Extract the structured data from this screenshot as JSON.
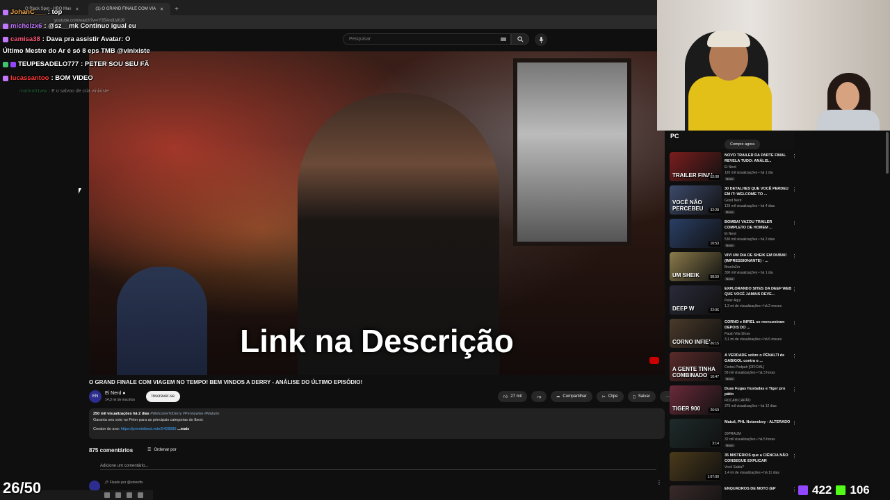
{
  "browser": {
    "tabs": [
      {
        "label": "O Black Spot - HBO Max"
      },
      {
        "label": "(1) O GRAND FINALE COM VIA"
      }
    ],
    "url": "youtube.com/watch?v=rY35AndLWU9"
  },
  "youtube": {
    "search_placeholder": "Pesquisar",
    "video_overlay_text": "Link na Descrição",
    "video_title": "O GRAND FINALE COM VIAGEM NO TEMPO! BEM VINDOS A DERRY - ANÁLISE DO ÚLTIMO EPISÓDIO!",
    "channel": {
      "name": "Ei Nerd",
      "subscribers": "14,3 mi de inscritos",
      "avatar": "EN"
    },
    "subscribe_label": "Inscrever-se",
    "actions": {
      "likes": "27 mil",
      "share": "Compartilhar",
      "clip": "Clipe",
      "save": "Salvar",
      "more": "⋯"
    },
    "description": {
      "stats": "250 mil visualizações  há 2 dias",
      "tags": "#WelcomeToDerry #Pennywise #Maturin",
      "line1": "Garanta seu voto no Peter para as principais categorias do Ibest:",
      "line2_prefix": "Creator do ano:",
      "link": "https://premioibest.vote/5408685",
      "more": "...mais"
    },
    "comments": {
      "count": "875 comentários",
      "sort_label": "Ordenar por",
      "add_placeholder": "Adicione um comentário...",
      "pinned_by": "Fixado por @einerdtv"
    }
  },
  "chat": [
    {
      "user": "JohanC___",
      "message": ": top",
      "user_color": "#f2a64a"
    },
    {
      "user": "michelzx6",
      "message": ": @sz__mk Continuo igual eu",
      "user_color": "#c277ff"
    },
    {
      "user": "camisa38",
      "message": ": Dava pra assistir Avatar: O",
      "user_color": "#ff5a7a"
    },
    {
      "user": "",
      "message": "Último Mestre do Ar é só 8 eps TMB @vinixiste",
      "user_color": "#ffffff"
    },
    {
      "user": "TEUPESADELO777",
      "message": ": PETER SOU SEU FÃ",
      "user_color": "#ffffff"
    },
    {
      "user": "lucassantoo",
      "message": ": BOM VIDEO",
      "user_color": "#ff3b3b"
    },
    {
      "user": "marlon01ww",
      "message": ": E o salvoo de cria vinixiste",
      "user_color": "#3ec46d"
    }
  ],
  "recommendations": {
    "ad": {
      "logo": "PC",
      "button": "Compre agora"
    },
    "items": [
      {
        "title": "NOVO TRAILER DA PARTE FINAL REVELA TUDO: ANÁLIS...",
        "channel": "Ei Nerd",
        "meta": "192 mil visualizações • há 1 dia",
        "badge": "Novo",
        "duration": "12:08",
        "thumb_text": "TRAILER FINAL",
        "thumb_color": "#7a1d1d"
      },
      {
        "title": "30 DETALHES QUE VOCÊ PERDEU EM IT: WELCOME TO ...",
        "channel": "Good Nerd",
        "meta": "125 mil visualizações • há 4 dias",
        "badge": "Novo",
        "duration": "32:28",
        "thumb_text": "VOCÊ NÃO PERCEBEU",
        "thumb_color": "#3d4a6b"
      },
      {
        "title": "BOMBA! VAZOU TRAILER COMPLETO DE HOMEM ...",
        "channel": "Ei Nerd",
        "meta": "530 mil visualizações • há 2 dias",
        "badge": "Novo",
        "duration": "10:53",
        "thumb_text": "",
        "thumb_color": "#2a3f66"
      },
      {
        "title": "VIVI UM DIA DE SHEIK EM DUBAI! (IMPRESSIONANTE) - ...",
        "channel": "BrunInZor",
        "meta": "300 mil visualizações • há 1 dia",
        "badge": "Novo",
        "duration": "58:59",
        "thumb_text": "UM SHEIK",
        "thumb_color": "#8a7a4a"
      },
      {
        "title": "EXPLORANDO SITES DA DEEP WEB QUE VOCÊ JAMAIS DEVE...",
        "channel": "Peter Aqui",
        "meta": "1,3 mi de visualizações • há 2 meses",
        "badge": "",
        "duration": "22:06",
        "thumb_text": "DEEP W",
        "thumb_color": "#2a2a3a"
      },
      {
        "title": "CORNO e INFIEL se reencontram DEPOIS DO ...",
        "channel": "Paulo Vita Show",
        "meta": "3,1 mi de visualizações • há 6 meses",
        "badge": "",
        "duration": "26:15",
        "thumb_text": "CORNO  INFIEL",
        "thumb_color": "#4a3a2a"
      },
      {
        "title": "A VERDADE sobre o PÊNALTI de GABIGOL contra o ...",
        "channel": "Cortes Podpah [OFICIAL]",
        "meta": "58 mil visualizações • há 3 horas",
        "badge": "Novo",
        "duration": "10:47",
        "thumb_text": "A GENTE TINHA COMBINADO",
        "thumb_color": "#5a2a2a"
      },
      {
        "title": "Duas Fugas frustadas e Tiger pro pátio",
        "channel": "ROCAM CAPÃO",
        "meta": "375 mil visualizações • há 12 dias",
        "badge": "",
        "duration": "26:59",
        "thumb_text": "TIGER 900",
        "thumb_color": "#6a2a3a"
      },
      {
        "title": "Matuê, PHL Notaveboy - ALTERADO",
        "channel": "30PRAUM",
        "meta": "32 mil visualizações • há 5 horas",
        "badge": "Novo",
        "duration": "3:14",
        "thumb_text": "",
        "thumb_color": "#1e2a2a"
      },
      {
        "title": "35 MISTÉRIOS que a CIÊNCIA NÃO CONSEGUE EXPLICAR",
        "channel": "Você Sabia?",
        "meta": "1,4 mi de visualizações • há 11 dias",
        "badge": "",
        "duration": "1:07:00",
        "thumb_text": "",
        "thumb_color": "#4a3a1a"
      },
      {
        "title": "ENQUADROS DE MOTO (EP",
        "channel": "",
        "meta": "",
        "badge": "",
        "duration": "",
        "thumb_text": "",
        "thumb_color": "#3a2a2a"
      }
    ]
  },
  "overlay": {
    "progress_counter": "26/50",
    "twitch_viewers": "422",
    "kick_viewers": "106"
  },
  "colors": {
    "accent": "#3ea6ff",
    "youtube_red": "#cc0000",
    "twitch": "#9146ff",
    "kick": "#53fc18"
  }
}
